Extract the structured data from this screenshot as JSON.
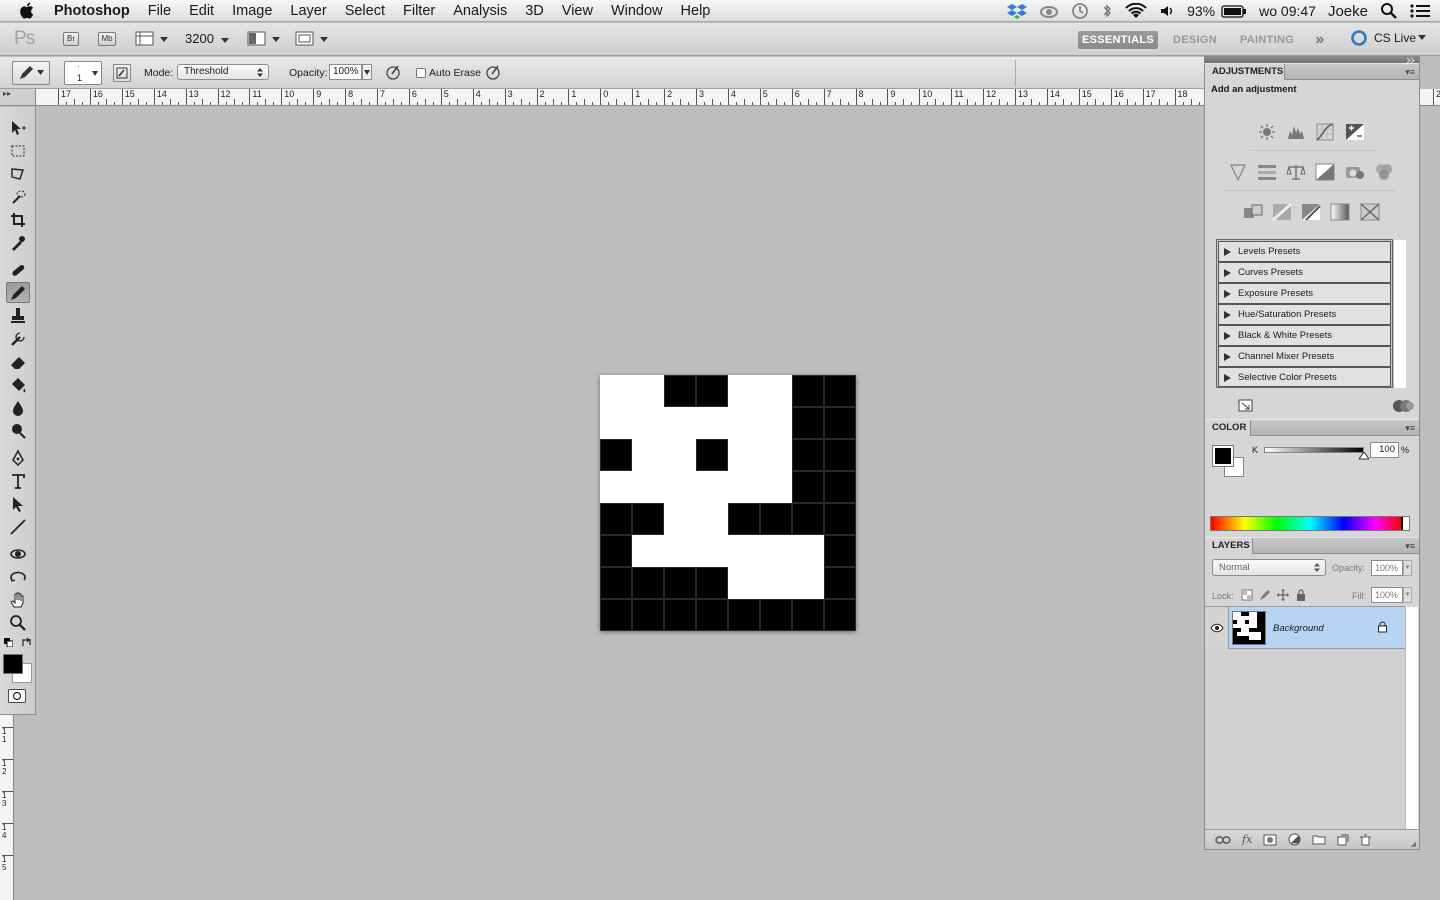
{
  "menubar": {
    "app_name": "Photoshop",
    "menus": [
      "File",
      "Edit",
      "Image",
      "Layer",
      "Select",
      "Filter",
      "Analysis",
      "3D",
      "View",
      "Window",
      "Help"
    ],
    "battery": "93%",
    "clock": "wo 09:47",
    "user": "Joeke"
  },
  "appbar": {
    "logo": "Ps",
    "bridge": "Br",
    "minibridge": "Mb",
    "zoom": "3200",
    "workspaces": [
      "ESSENTIALS",
      "DESIGN",
      "PAINTING"
    ],
    "active_workspace": "ESSENTIALS",
    "more": "»",
    "cslive": "CS Live"
  },
  "options": {
    "brush_size": "1",
    "mode_label": "Mode:",
    "mode_value": "Threshold",
    "opacity_label": "Opacity:",
    "opacity_value": "100%",
    "auto_erase_label": "Auto Erase"
  },
  "rulers": {
    "horizontal": [
      "17",
      "16",
      "15",
      "14",
      "13",
      "12",
      "11",
      "10",
      "9",
      "8",
      "7",
      "6",
      "5",
      "4",
      "3",
      "2",
      "1",
      "0",
      "1",
      "2",
      "3",
      "4",
      "5",
      "6",
      "7",
      "8",
      "9",
      "10",
      "11",
      "12",
      "13",
      "14",
      "15",
      "16",
      "17",
      "18"
    ],
    "right_horizontal": "2",
    "vertical": [
      "1",
      "2",
      "3",
      "4",
      "5"
    ]
  },
  "canvas": {
    "grid": [
      "WWBBWWBB",
      "WWWWWWBB",
      "BWWBWWBB",
      "WWWWWWBB",
      "BBWWBBBB",
      "BWWWWWWB",
      "BBBBWWWB",
      "BBBBBBBB"
    ],
    "black": "#000000",
    "white": "#ffffff"
  },
  "adjustments": {
    "title": "ADJUSTMENTS",
    "subtitle": "Add an adjustment",
    "presets": [
      "Levels Presets",
      "Curves Presets",
      "Exposure Presets",
      "Hue/Saturation Presets",
      "Black & White Presets",
      "Channel Mixer Presets",
      "Selective Color Presets"
    ]
  },
  "color": {
    "title": "COLOR",
    "channel": "K",
    "value": "100",
    "unit": "%",
    "foreground": "#000000",
    "background": "#ffffff"
  },
  "layers": {
    "title": "LAYERS",
    "blend_mode": "Normal",
    "opacity_label": "Opacity:",
    "opacity_value": "100%",
    "lock_label": "Lock:",
    "fill_label": "Fill:",
    "fill_value": "100%",
    "items": [
      {
        "name": "Background"
      }
    ]
  },
  "accent": "#4a8ec9",
  "selected_layer_color": "#b8d4f5"
}
